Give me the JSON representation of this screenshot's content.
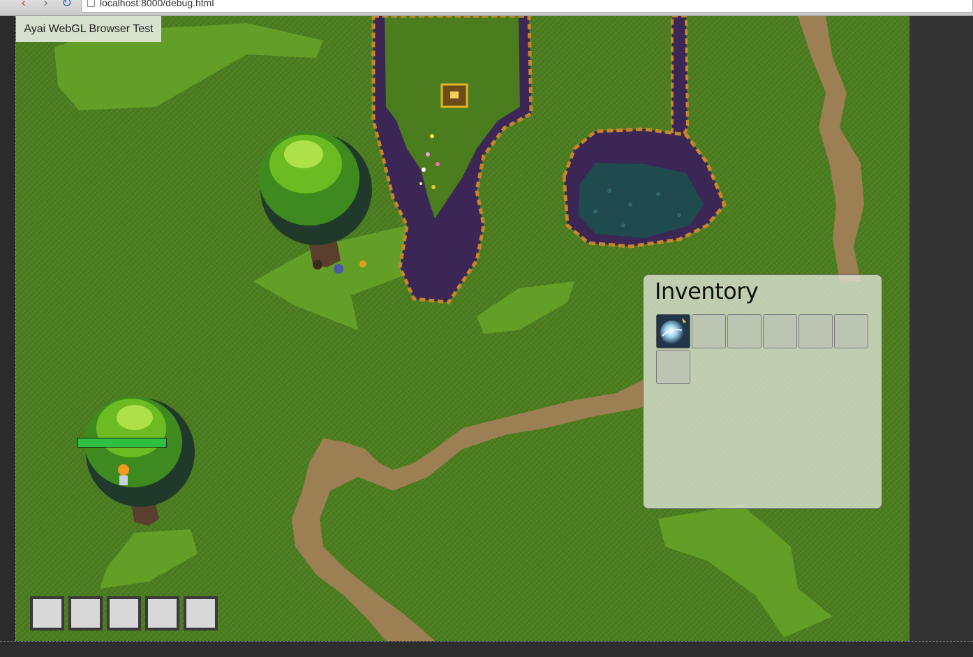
{
  "browser": {
    "url": "localhost:8000/debug.html"
  },
  "page": {
    "title": "Ayai WebGL Browser Test"
  },
  "inventory": {
    "title": "Inventory",
    "slot_count": 7,
    "items": [
      {
        "slot": 0,
        "icon": "ice-orb-icon"
      }
    ]
  },
  "player": {
    "health_fraction": 1.0,
    "health_color": "#2fbf43"
  },
  "hotbar": {
    "slot_count": 5
  },
  "colors": {
    "grass": "#4b7d1e",
    "path": "#9c7f52",
    "water": "#1f4a4e",
    "cliff": "#3b2656"
  }
}
